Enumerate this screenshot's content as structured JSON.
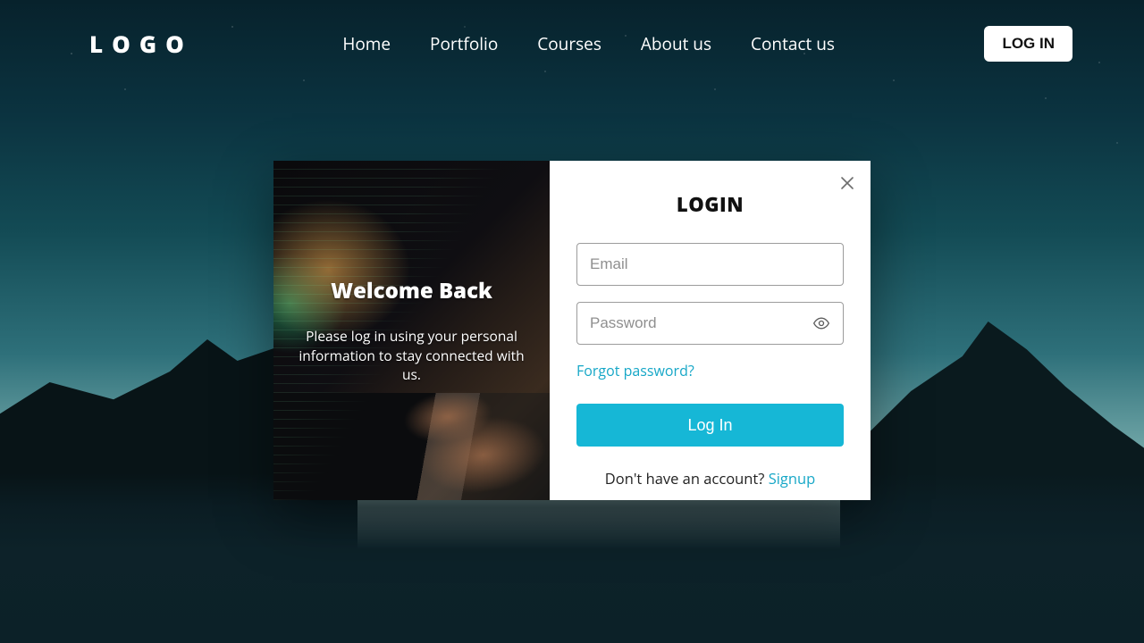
{
  "brand": {
    "logo_text": "LOGO"
  },
  "nav": {
    "items": [
      {
        "label": "Home"
      },
      {
        "label": "Portfolio"
      },
      {
        "label": "Courses"
      },
      {
        "label": "About us"
      },
      {
        "label": "Contact us"
      }
    ],
    "login_button": "LOG IN"
  },
  "modal": {
    "welcome": {
      "title": "Welcome Back",
      "text": "Please log in using your personal information to stay connected with us."
    },
    "form": {
      "title": "LOGIN",
      "email_placeholder": "Email",
      "password_placeholder": "Password",
      "forgot": "Forgot password?",
      "submit": "Log In",
      "signup_prompt": "Don't have an account? ",
      "signup_link": "Signup"
    }
  },
  "colors": {
    "accent": "#16b7d6",
    "link": "#16a7c7"
  }
}
